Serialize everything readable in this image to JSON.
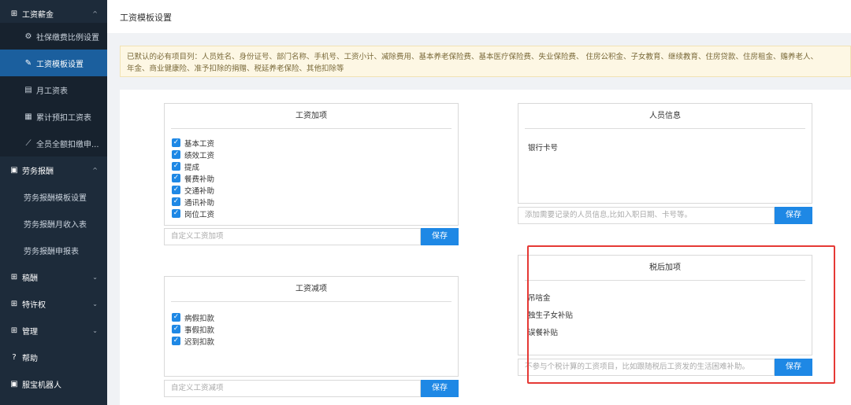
{
  "sidebar": {
    "group1": {
      "label": "工资薪金",
      "icon": "grid-icon"
    },
    "group1_items": [
      {
        "label": "社保缴费比例设置",
        "icon": "gear-icon"
      },
      {
        "label": "工资模板设置",
        "icon": "edit-icon"
      },
      {
        "label": "月工资表",
        "icon": "bar-chart-icon"
      },
      {
        "label": "累计预扣工资表",
        "icon": "table-icon"
      },
      {
        "label": "全员全额扣缴申...",
        "icon": "trend-icon"
      }
    ],
    "group2": {
      "label": "劳务报酬",
      "icon": "doc-icon"
    },
    "group2_items": [
      {
        "label": "劳务报酬模板设置"
      },
      {
        "label": "劳务报酬月收入表"
      },
      {
        "label": "劳务报酬申报表"
      }
    ],
    "group3": {
      "label": "稿酬"
    },
    "group4": {
      "label": "特许权"
    },
    "group5": {
      "label": "管理"
    },
    "group6": {
      "label": "帮助"
    },
    "group7": {
      "label": "服宝机器人"
    }
  },
  "page": {
    "title": "工资模板设置",
    "notice_line1": "已默认的必有项目列：人员姓名、身份证号、部门名称、手机号、工资小计、减除费用、基本养老保险费、基本医疗保险费、失业保险费、 住房公积金、子女教育、继续教育、住房贷款、住房租金、赡养老人、",
    "notice_line2": "年金、商业健康险、准予扣除的捐赠、税延养老保险、其他扣除等"
  },
  "salary_add": {
    "title": "工资加项",
    "items": [
      "基本工资",
      "绩效工资",
      "提成",
      "餐费补助",
      "交通补助",
      "通讯补助",
      "岗位工资"
    ],
    "placeholder": "自定义工资加项",
    "save": "保存"
  },
  "salary_deduct": {
    "title": "工资减项",
    "items": [
      "病假扣款",
      "事假扣款",
      "迟到扣款"
    ],
    "placeholder": "自定义工资减项",
    "save": "保存"
  },
  "person_info": {
    "title": "人员信息",
    "items": [
      "银行卡号"
    ],
    "placeholder": "添加需要记录的人员信息,比如入职日期、卡号等。",
    "save": "保存"
  },
  "after_tax": {
    "title": "税后加项",
    "items": [
      "吊唁金",
      "独生子女补贴",
      "误餐补贴"
    ],
    "placeholder": "不参与个税计算的工资项目，比如跟随税后工资发的生活困难补助。",
    "save": "保存"
  }
}
